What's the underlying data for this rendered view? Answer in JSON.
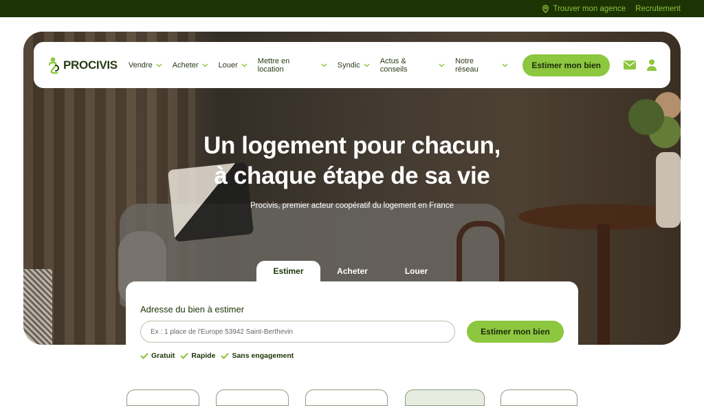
{
  "topbar": {
    "agency_label": "Trouver mon agence",
    "jobs_label": "Recrutement",
    "agency_icon": "location-pin-icon"
  },
  "nav": {
    "logo_text": "PROCIVIS",
    "items": [
      {
        "label": "Vendre"
      },
      {
        "label": "Acheter"
      },
      {
        "label": "Louer"
      },
      {
        "label": "Mettre en location"
      },
      {
        "label": "Syndic"
      },
      {
        "label": "Actus & conseils"
      },
      {
        "label": "Notre réseau"
      }
    ],
    "cta_label": "Estimer mon bien",
    "icons": [
      "mail-icon",
      "user-icon"
    ]
  },
  "hero": {
    "title_line1": "Un logement pour chacun,",
    "title_line2": "à chaque étape de sa vie",
    "subtitle": "Procivis, premier acteur coopératif du logement en France"
  },
  "search": {
    "tabs": [
      {
        "label": "Estimer",
        "active": true
      },
      {
        "label": "Acheter",
        "active": false
      },
      {
        "label": "Louer",
        "active": false
      }
    ],
    "field_label": "Adresse du bien à estimer",
    "placeholder": "Ex : 1 place de l'Europe 53942 Saint-Berthevin",
    "button_label": "Estimer mon bien",
    "features": [
      {
        "label": "Gratuit"
      },
      {
        "label": "Rapide"
      },
      {
        "label": "Sans engagement"
      }
    ]
  },
  "colors": {
    "brand_dark": "#1c3303",
    "accent_green": "#8dc63f"
  }
}
